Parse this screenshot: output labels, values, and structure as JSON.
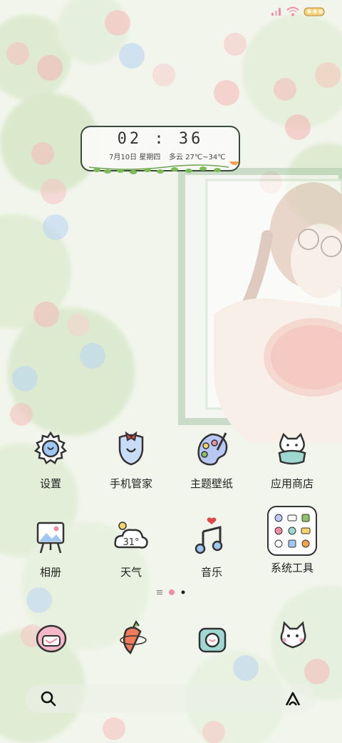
{
  "status_bar": {
    "icons": [
      "signal-icon",
      "wifi-icon",
      "battery-icon"
    ]
  },
  "clock_widget": {
    "time": "02 : 36",
    "date": "7月10日 星期四",
    "weather": "多云 27℃~34℃"
  },
  "apps": {
    "row1": [
      {
        "label": "设置",
        "icon": "gear-icon"
      },
      {
        "label": "手机管家",
        "icon": "shield-icon"
      },
      {
        "label": "主题壁纸",
        "icon": "palette-icon"
      },
      {
        "label": "应用商店",
        "icon": "store-cat-icon"
      }
    ],
    "row2": [
      {
        "label": "相册",
        "icon": "gallery-icon"
      },
      {
        "label": "天气",
        "icon": "weather-icon",
        "badge": "31°"
      },
      {
        "label": "音乐",
        "icon": "music-icon"
      },
      {
        "label": "系统工具",
        "icon": "folder-icon"
      }
    ]
  },
  "dock": [
    "messages-icon",
    "browser-icon",
    "camera-icon",
    "contacts-icon"
  ],
  "pager": {
    "pages": 2,
    "current": 2
  },
  "colors": {
    "outline": "#333333",
    "accent_pink": "#f28ca0",
    "accent_blue": "#9ec8f2",
    "accent_green": "#8fc06a",
    "accent_orange": "#f5a14a"
  }
}
